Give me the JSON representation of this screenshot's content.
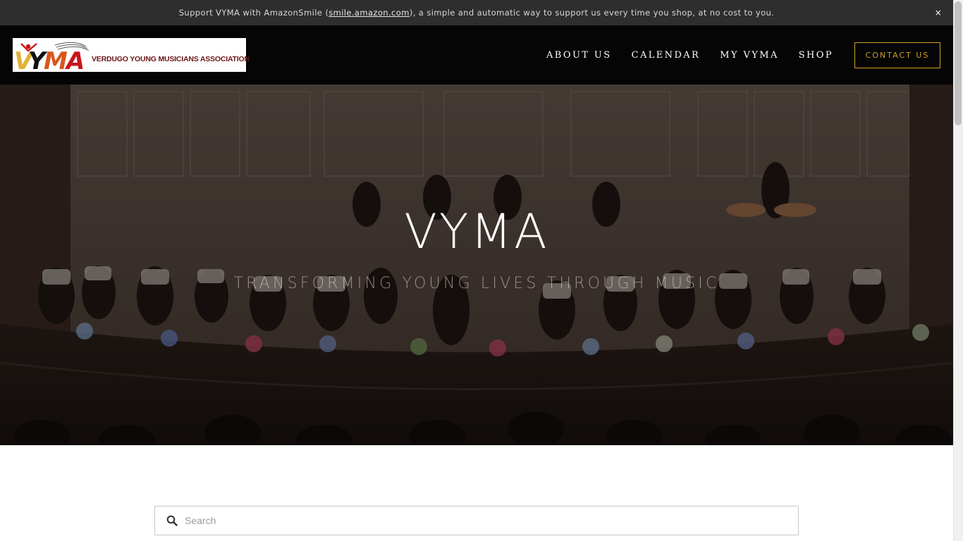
{
  "announcement": {
    "text_before": "Support VYMA with AmazonSmile (",
    "link_text": "smile.amazon.com",
    "text_after": "), a simple and automatic way to support us every time you shop, at no cost to you.",
    "close_label": "×"
  },
  "header": {
    "logo_mark": "VYMA",
    "logo_name": "VERDUGO YOUNG MUSICIANS ASSOCIATION",
    "nav": [
      {
        "label": "ABOUT US"
      },
      {
        "label": "CALENDAR"
      },
      {
        "label": "MY VYMA"
      },
      {
        "label": "SHOP"
      }
    ],
    "contact_label": "CONTACT US"
  },
  "hero": {
    "title": "VYMA",
    "subtitle": "TRANSFORMING YOUNG LIVES THROUGH MUSIC"
  },
  "search": {
    "placeholder": "Search",
    "value": ""
  },
  "colors": {
    "accent": "#c9a227",
    "header_bg": "#050505",
    "announce_bg": "#2e2e2e"
  },
  "icons": {
    "search": "search-icon",
    "close": "close-icon"
  }
}
